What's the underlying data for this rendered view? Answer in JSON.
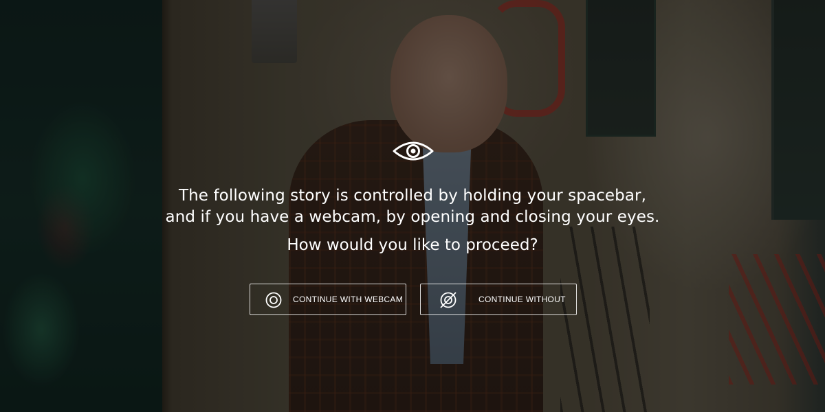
{
  "intro": {
    "line1": "The following story is controlled by holding your spacebar,",
    "line2": "and if you have a webcam, by opening and closing your eyes.",
    "question": "How would you like to proceed?",
    "icon": "eye-icon"
  },
  "buttons": {
    "webcam": {
      "label": "CONTINUE WITH WEBCAM",
      "icon": "webcam-ring-icon"
    },
    "without": {
      "label": "CONTINUE WITHOUT",
      "icon": "webcam-off-icon"
    }
  },
  "colors": {
    "text": "#ffffff",
    "overlay": "rgba(0,0,0,0.52)",
    "button_border": "#ffffff"
  }
}
